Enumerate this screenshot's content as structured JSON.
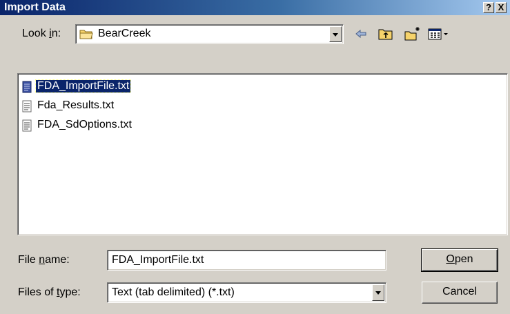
{
  "window": {
    "title": "Import Data",
    "help_label": "?",
    "close_label": "X"
  },
  "look_in": {
    "label_pre": "Look ",
    "label_accel": "i",
    "label_post": "n:",
    "value": "BearCreek"
  },
  "toolbar": {
    "icons": [
      "back-arrow-icon",
      "up-one-level-icon",
      "new-folder-icon",
      "view-menu-icon"
    ]
  },
  "files": [
    {
      "name": "FDA_ImportFile.txt",
      "selected": true
    },
    {
      "name": "Fda_Results.txt",
      "selected": false
    },
    {
      "name": "FDA_SdOptions.txt",
      "selected": false
    }
  ],
  "file_name": {
    "label_pre": "File ",
    "label_accel": "n",
    "label_post": "ame:",
    "value": "FDA_ImportFile.txt"
  },
  "file_type": {
    "label_pre": "Files of ",
    "label_accel": "t",
    "label_post": "ype:",
    "value": "Text (tab delimited) (*.txt)"
  },
  "buttons": {
    "open_accel": "O",
    "open_rest": "pen",
    "cancel": "Cancel"
  },
  "colors": {
    "title_start": "#0a246a",
    "title_end": "#a6caf0",
    "face": "#d4d0c8",
    "selection": "#0a246a"
  }
}
